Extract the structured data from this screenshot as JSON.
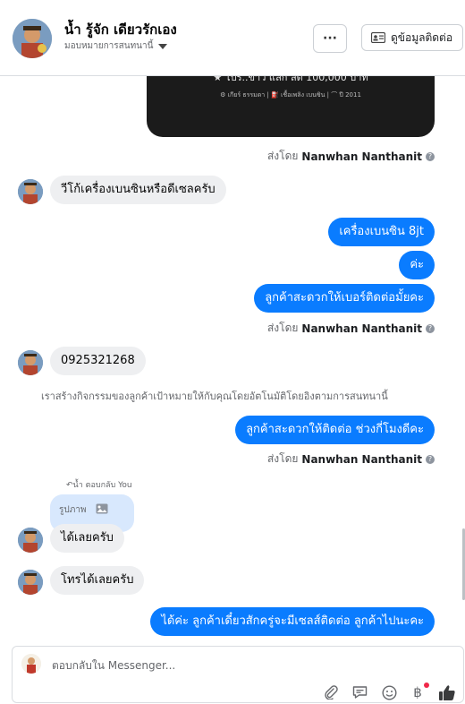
{
  "header": {
    "contact_name": "น้ำ รู้จัก เดียวรักเอง",
    "assign_label": "มอบหมายการสนทนานี้",
    "more_label": "···",
    "contact_info_label": "ดูข้อมูลติดต่อ"
  },
  "promo_card": {
    "headline": "★ โปร..ข่าว แลก ลด 100,000 บาท",
    "details": "⚙ เกียร์ ธรรมดา  |  ⛽ เชื้อเพลิง เบนซิน  |  ⌒ ปี 2011"
  },
  "sender_label": "ส่งโดย",
  "sender_name": "Nanwhan Nanthanit",
  "messages": {
    "m1": "วีโก้เครื่องเบนซินหรือดีเซลครับ",
    "m2": "เครื่องเบนซิน 8jt",
    "m3": "ค่ะ",
    "m4": "ลูกค้าสะดวกให้เบอร์ติดต่อมั้ยคะ",
    "m5": "0925321268",
    "m6": "ลูกค้าสะดวกให้ติดต่อ ช่วงกี่โมงดีคะ",
    "m7": "ได้เลยครับ",
    "m8": "โทรได้เลยครับ",
    "m9": "ได้ค่ะ ลูกค้าเดี๋ยวสักครู่จะมีเซลส์ติดต่อ ลูกค้าไปนะคะ"
  },
  "system_note": "เราสร้างกิจกรรมของลูกค้าเป้าหมายให้กับคุณโดยอัตโนมัติโดยอิงตามการสนทนานี้",
  "reply_context": {
    "meta": "น้ำ ตอบกลับ You",
    "quoted": "รูปภาพ"
  },
  "composer": {
    "placeholder": "ตอบกลับใน Messenger..."
  },
  "colors": {
    "outgoing_bubble": "#0a7cff",
    "incoming_bubble": "#eeeff1",
    "reply_bubble": "#d8e8fd"
  },
  "icons": [
    "more-icon",
    "contact-card-icon",
    "attach-icon",
    "saved-reply-icon",
    "emoji-icon",
    "baht-icon",
    "thumbs-up-icon",
    "image-icon",
    "question-icon"
  ]
}
